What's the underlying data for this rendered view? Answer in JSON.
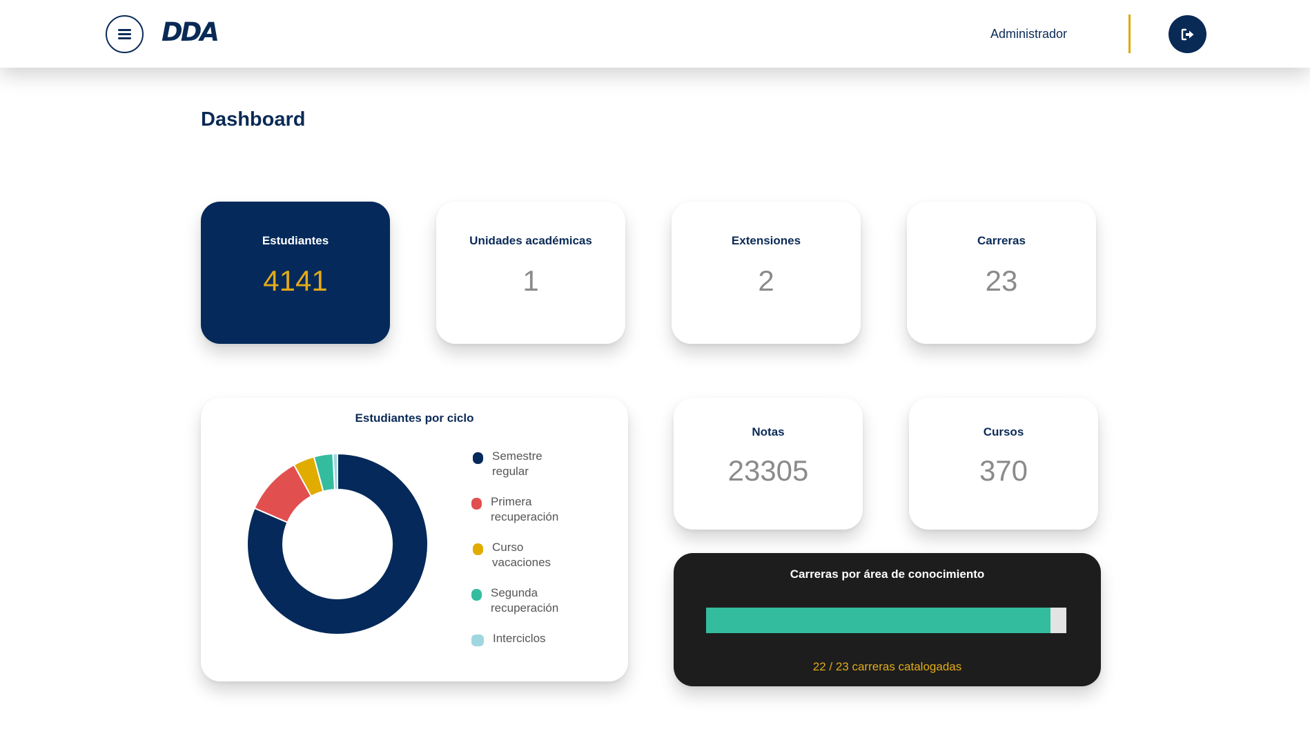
{
  "header": {
    "logo": "DDA",
    "user_name": "Administrador",
    "menu_icon": "hamburger-menu-icon",
    "logout_icon": "logout-icon"
  },
  "page": {
    "title": "Dashboard"
  },
  "stats": [
    {
      "label": "Estudiantes",
      "value": "4141"
    },
    {
      "label": "Unidades académicas",
      "value": "1"
    },
    {
      "label": "Extensiones",
      "value": "2"
    },
    {
      "label": "Carreras",
      "value": "23"
    },
    {
      "label": "Notas",
      "value": "23305"
    },
    {
      "label": "Cursos",
      "value": "370"
    }
  ],
  "donut": {
    "title": "Estudiantes por ciclo",
    "legend": [
      {
        "label": "Semestre regular",
        "color": "#04295a"
      },
      {
        "label": "Primera recuperación",
        "color": "#e24f4f"
      },
      {
        "label": "Curso vacaciones",
        "color": "#e0ac00"
      },
      {
        "label": "Segunda recuperación",
        "color": "#34bc9f"
      },
      {
        "label": "Interciclos",
        "color": "#9fd6e0"
      }
    ]
  },
  "chart_data": {
    "type": "pie",
    "title": "Estudiantes por ciclo",
    "categories": [
      "Semestre regular",
      "Primera recuperación",
      "Curso vacaciones",
      "Segunda recuperación",
      "Interciclos"
    ],
    "values": [
      81.5,
      10.5,
      3.8,
      3.4,
      0.8
    ],
    "unit": "% approx. (estimated from slice angles)",
    "donut": true,
    "legend_position": "right"
  },
  "carreras_area": {
    "title": "Carreras por área de conocimiento",
    "catalogued": 22,
    "total": 23,
    "progress_text": "22 / 23 carreras catalogadas",
    "fill_color": "#34bc9f"
  }
}
